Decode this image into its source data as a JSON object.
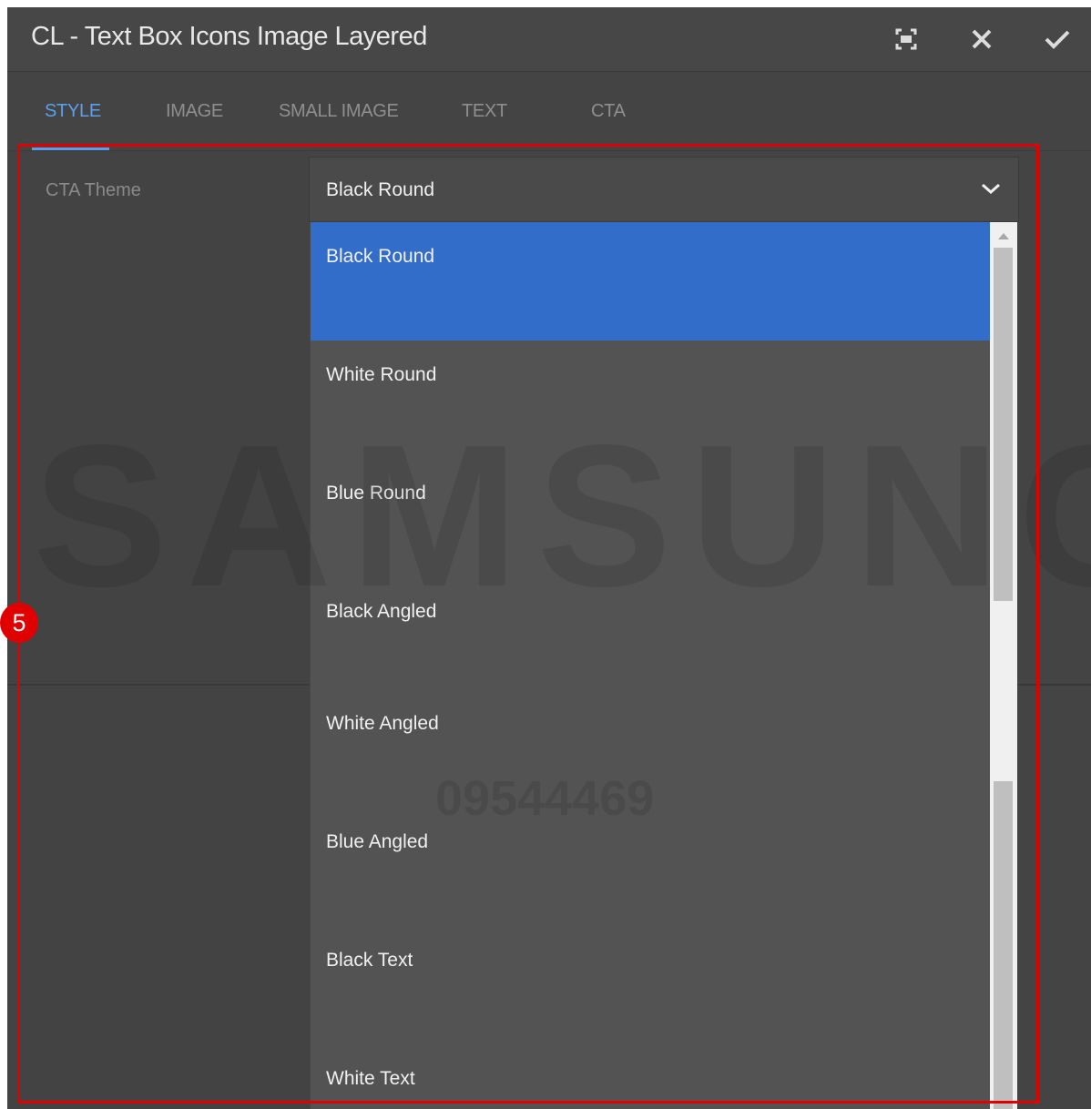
{
  "dialog": {
    "title": "CL - Text Box Icons Image Layered",
    "buttons": [
      {
        "name": "fullscreen",
        "icon": "fullscreen-icon"
      },
      {
        "name": "cancel",
        "icon": "close-icon"
      },
      {
        "name": "done",
        "icon": "checkmark-icon"
      }
    ]
  },
  "tabs": [
    {
      "label": "STYLE",
      "active": true
    },
    {
      "label": "IMAGE",
      "active": false
    },
    {
      "label": "SMALL IMAGE",
      "active": false
    },
    {
      "label": "TEXT",
      "active": false
    },
    {
      "label": "CTA",
      "active": false
    }
  ],
  "field": {
    "label": "CTA Theme",
    "selected_value": "Black Round"
  },
  "dropdown": {
    "options": [
      {
        "label": "Black Round",
        "selected": true
      },
      {
        "label": "White Round",
        "selected": false
      },
      {
        "label": "Blue Round",
        "selected": false
      },
      {
        "label": "Black Angled",
        "selected": false
      },
      {
        "label": "White Angled",
        "selected": false
      },
      {
        "label": "Blue Angled",
        "selected": false
      },
      {
        "label": "Black Text",
        "selected": false
      },
      {
        "label": "White Text",
        "selected": false
      }
    ]
  },
  "watermark": {
    "brand": "SAMSUNG",
    "number": "09544469"
  },
  "annotation": {
    "badge": "5"
  },
  "colors": {
    "accent": "#5aa0ec",
    "selection": "#326dc9",
    "annotation": "#e00000"
  }
}
